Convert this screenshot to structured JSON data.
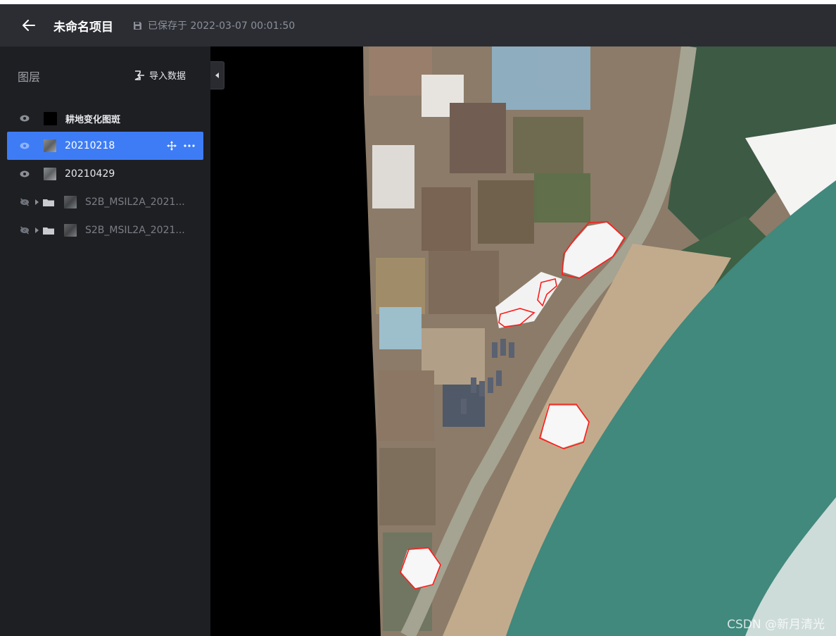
{
  "header": {
    "back_icon": "arrow-left-icon",
    "title": "未命名项目",
    "save_icon": "save-icon",
    "save_status": "已保存于 2022-03-07 00:01:50"
  },
  "sidebar": {
    "layers_label": "图层",
    "import_label": "导入数据",
    "import_icon": "import-icon",
    "collapse_icon": "caret-left-icon",
    "layers": [
      {
        "name": "耕地变化图斑",
        "visible": true,
        "selected": false,
        "thumb": "black-swatch"
      },
      {
        "name": "20210218",
        "visible": true,
        "selected": true,
        "thumb": "satellite-thumbnail"
      },
      {
        "name": "20210429",
        "visible": true,
        "selected": false,
        "thumb": "satellite-thumbnail"
      },
      {
        "name": "S2B_MSIL2A_2021...",
        "visible": false,
        "selected": false,
        "thumb": "satellite-thumbnail",
        "type": "group"
      },
      {
        "name": "S2B_MSIL2A_2021...",
        "visible": false,
        "selected": false,
        "thumb": "satellite-thumbnail",
        "type": "group"
      }
    ]
  },
  "map": {
    "watermark": "CSDN @新月清光"
  },
  "colors": {
    "header_bg": "#2b2d33",
    "sidebar_bg": "#1e1f23",
    "selected_bg": "#3d7cf5",
    "outline_red": "#ff1a1a"
  }
}
